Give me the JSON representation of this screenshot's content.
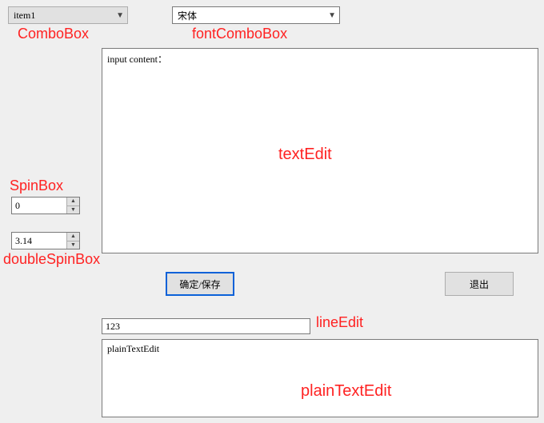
{
  "comboBox": {
    "selected": "item1"
  },
  "fontComboBox": {
    "selected": "宋体"
  },
  "textEdit": {
    "content": "input content："
  },
  "spinBox": {
    "value": "0"
  },
  "doubleSpinBox": {
    "value": "3.14"
  },
  "buttons": {
    "ok_save": "确定/保存",
    "exit": "退出"
  },
  "lineEdit": {
    "value": "123"
  },
  "plainTextEdit": {
    "content": "plainTextEdit"
  },
  "annotations": {
    "comboBox": "ComboBox",
    "fontComboBox": "fontComboBox",
    "textEdit": "textEdit",
    "spinBox": "SpinBox",
    "doubleSpinBox": "doubleSpinBox",
    "lineEdit": "lineEdit",
    "plainTextEdit": "plainTextEdit"
  }
}
